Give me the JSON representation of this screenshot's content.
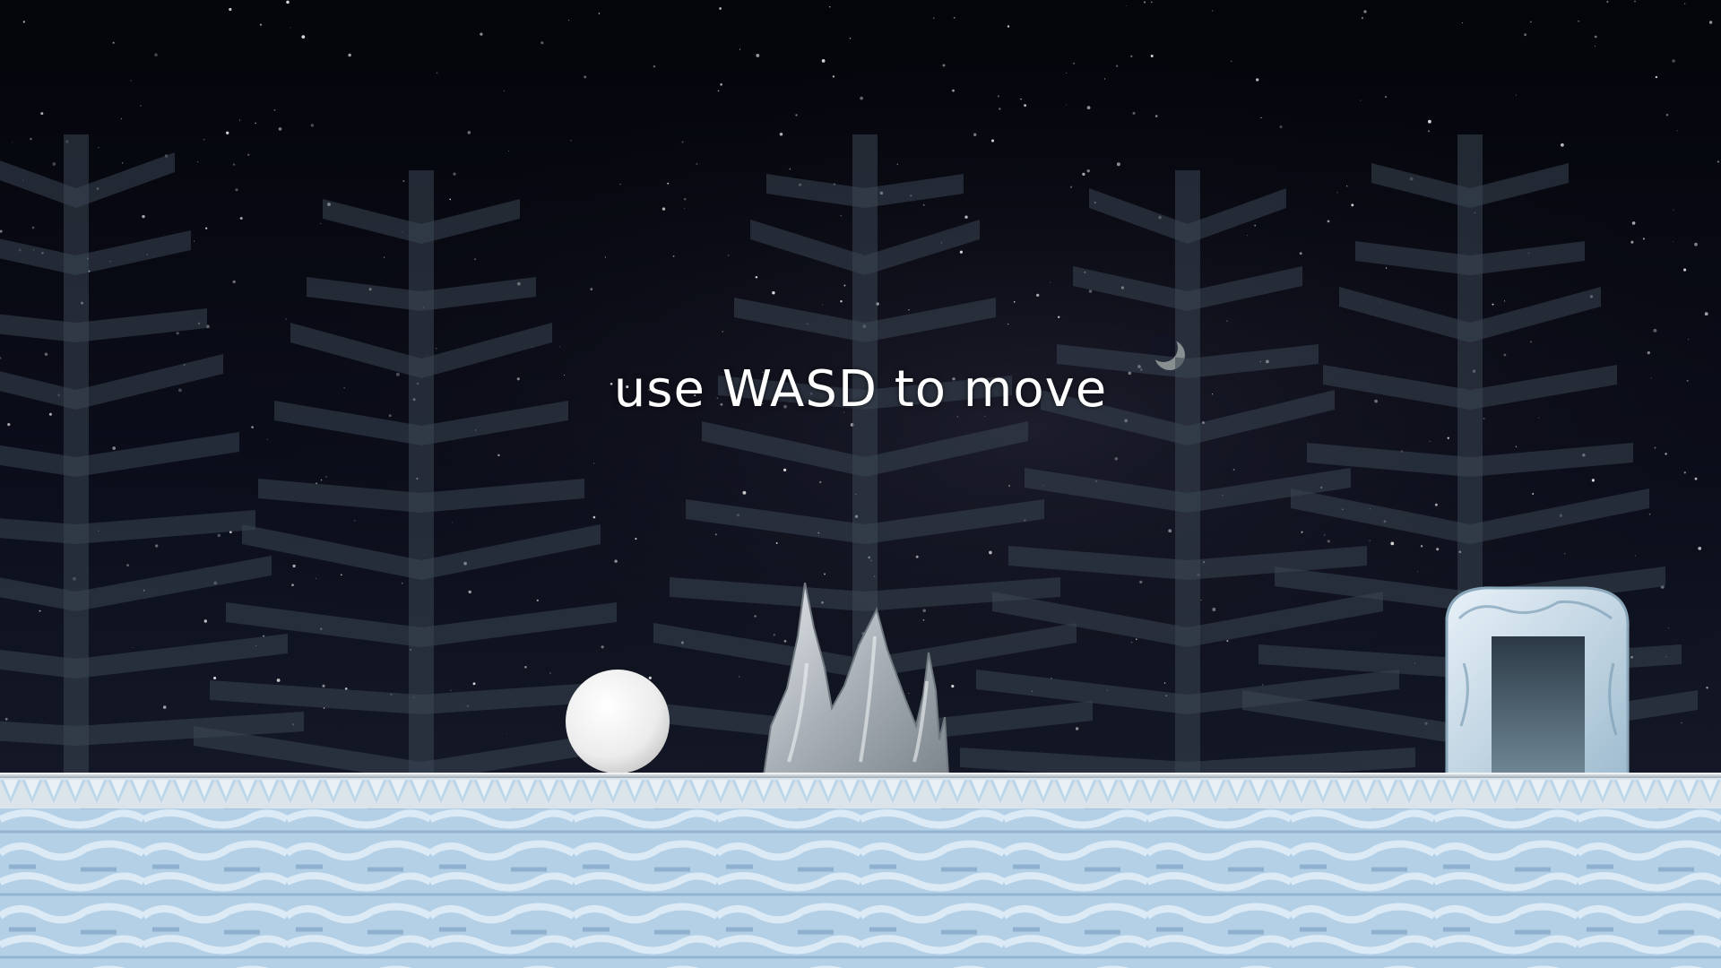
{
  "hud": {
    "hint_text": "use WASD to move"
  },
  "scene": {
    "theme": "night snowy forest",
    "moon": "crescent-moon-icon",
    "player": "snowball",
    "hazard": "ice-spikes",
    "exit": "ice-portal-door",
    "ground": "ice-brick-floor"
  },
  "colors": {
    "sky": "#05060c",
    "tree_silhouette": "#2a3440",
    "ice_light": "#cfe3f2",
    "ice_mid": "#a9c7e0",
    "ice_dark": "#8fb1cf",
    "snowball": "#f2f2f2",
    "text": "#ffffff"
  }
}
